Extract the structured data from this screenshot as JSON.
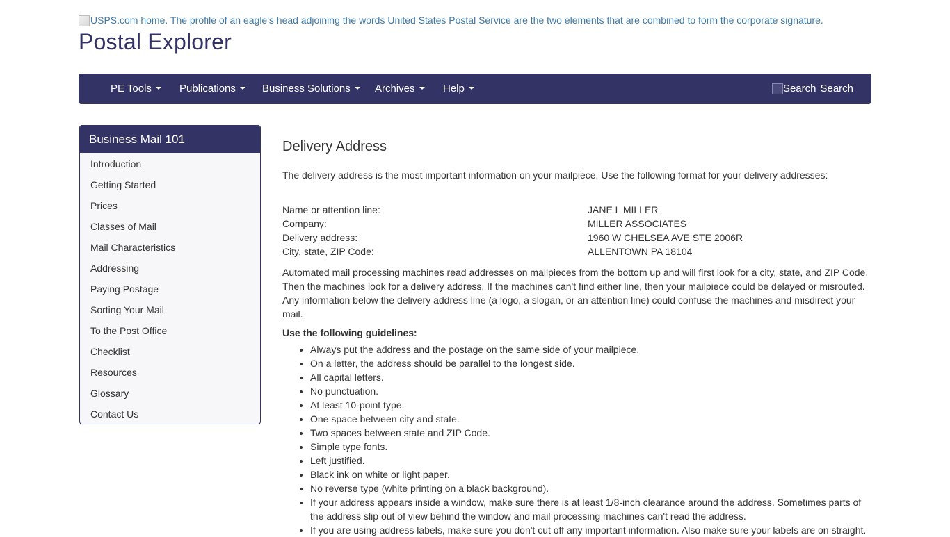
{
  "header": {
    "logo_alt": "USPS.com home. The profile of an eagle's head adjoining the words United States Postal Service are the two elements that are combined to form the corporate signature.",
    "site_title": "Postal Explorer"
  },
  "nav": {
    "items": [
      {
        "label": "PE Tools"
      },
      {
        "label": "Publications"
      },
      {
        "label": "Business Solutions"
      },
      {
        "label": "Archives"
      },
      {
        "label": "Help"
      }
    ],
    "search_img_alt": "Search",
    "search_label": "Search"
  },
  "sidebar": {
    "title": "Business Mail 101",
    "items": [
      {
        "label": "Introduction"
      },
      {
        "label": "Getting Started"
      },
      {
        "label": "Prices"
      },
      {
        "label": "Classes of Mail"
      },
      {
        "label": "Mail Characteristics"
      },
      {
        "label": "Addressing"
      },
      {
        "label": "Paying Postage"
      },
      {
        "label": "Sorting Your Mail"
      },
      {
        "label": "To the Post Office"
      },
      {
        "label": "Checklist"
      },
      {
        "label": "Resources"
      },
      {
        "label": "Glossary"
      },
      {
        "label": "Contact Us"
      }
    ]
  },
  "content": {
    "heading": "Delivery Address",
    "intro": "The delivery address is the most important information on your mailpiece. Use the following format for your delivery addresses:",
    "address_rows": [
      {
        "label": "Name or attention line:",
        "value": "JANE L MILLER"
      },
      {
        "label": "Company:",
        "value": "MILLER ASSOCIATES"
      },
      {
        "label": "Delivery address:",
        "value": "1960 W CHELSEA AVE STE 2006R"
      },
      {
        "label": "City, state, ZIP Code:",
        "value": "ALLENTOWN PA 18104"
      }
    ],
    "paragraph": "Automated mail processing machines read addresses on mailpieces from the bottom up and will first look for a city, state, and ZIP Code. Then the machines look for a delivery address. If the machines can't find either line, then your mailpiece could be delayed or misrouted. Any information below the delivery address line (a logo, a slogan, or an attention line) could confuse the machines and misdirect your mail.",
    "guidelines_heading": "Use the following guidelines:",
    "guidelines": [
      "Always put the address and the postage on the same side of your mailpiece.",
      "On a letter, the address should be parallel to the longest side.",
      "All capital letters.",
      "No punctuation.",
      "At least 10-point type.",
      "One space between city and state.",
      "Two spaces between state and ZIP Code.",
      "Simple type fonts.",
      "Left justified.",
      "Black ink on white or light paper.",
      "No reverse type (white printing on a black background).",
      "If your address appears inside a window, make sure there is at least 1/8-inch clearance around the address. Sometimes parts of the address slip out of view behind the window and mail processing machines can't read the address.",
      "If you are using address labels, make sure you don't cut off any important information. Also make sure your labels are on straight."
    ]
  },
  "colors": {
    "brand": "#333366",
    "link": "#3e7aa8",
    "text": "#333333",
    "sidebar_bg": "#f7f7f9"
  }
}
